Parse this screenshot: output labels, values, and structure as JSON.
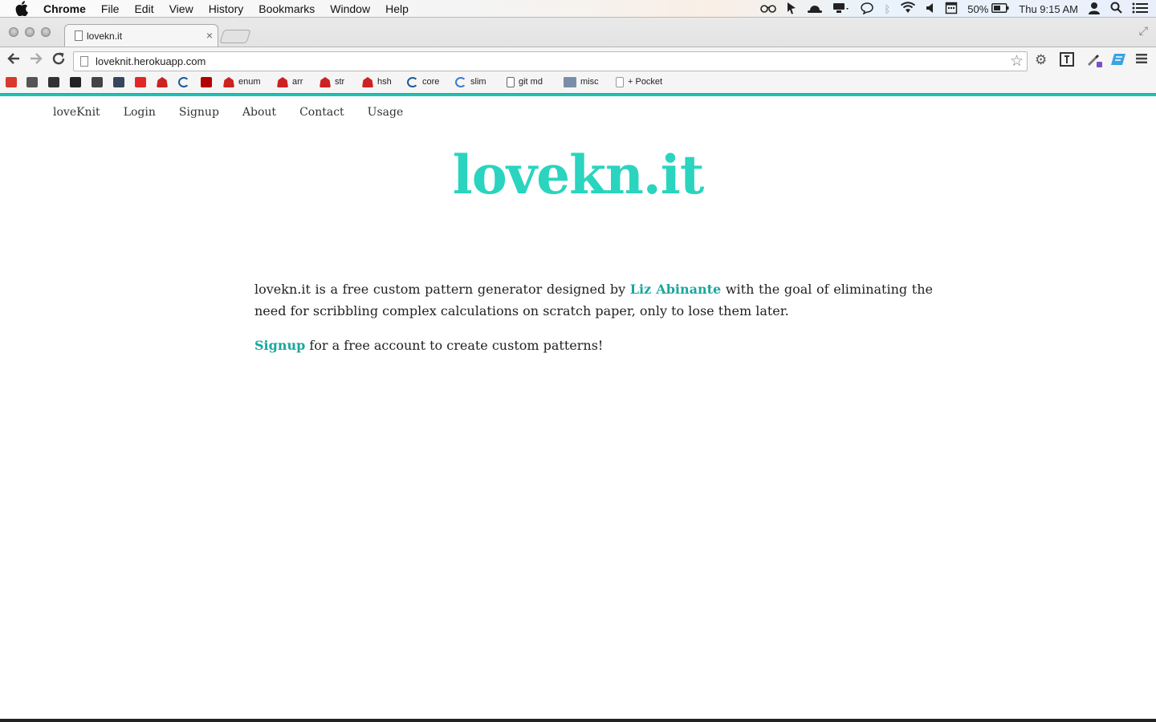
{
  "os_menubar": {
    "app_name": "Chrome",
    "menus": [
      "File",
      "Edit",
      "View",
      "History",
      "Bookmarks",
      "Window",
      "Help"
    ],
    "battery": "50%",
    "clock": "Thu 9:15 AM"
  },
  "browser": {
    "tab_title": "lovekn.it",
    "url": "loveknit.herokuapp.com",
    "bookmarks": [
      {
        "label": "",
        "icon": "gmail-icon",
        "color": "#d83a2e"
      },
      {
        "label": "",
        "icon": "puzzle-icon",
        "color": "#555555"
      },
      {
        "label": "",
        "icon": "circle-icon",
        "color": "#333333"
      },
      {
        "label": "",
        "icon": "github-icon",
        "color": "#222222"
      },
      {
        "label": "",
        "icon": "cloud-icon",
        "color": "#444444"
      },
      {
        "label": "",
        "icon": "tumblr-icon",
        "color": "#36465d"
      },
      {
        "label": "",
        "icon": "flipboard-icon",
        "color": "#e12828"
      },
      {
        "label": "",
        "icon": "ruby-icon",
        "color": "#cc2222"
      },
      {
        "label": "",
        "icon": "jquery-icon",
        "color": "#1b5b9a"
      },
      {
        "label": "",
        "icon": "rails-icon",
        "color": "#b30000"
      },
      {
        "label": "enum",
        "icon": "ruby-icon",
        "color": "#cc2222"
      },
      {
        "label": "arr",
        "icon": "ruby-icon",
        "color": "#cc2222"
      },
      {
        "label": "str",
        "icon": "ruby-icon",
        "color": "#cc2222"
      },
      {
        "label": "hsh",
        "icon": "ruby-icon",
        "color": "#cc2222"
      },
      {
        "label": "core",
        "icon": "jquery-icon",
        "color": "#1b5b9a"
      },
      {
        "label": "slim",
        "icon": "slim-icon",
        "color": "#3a7bd5"
      },
      {
        "label": "git md",
        "icon": "document-icon",
        "color": "#666666"
      },
      {
        "label": "misc",
        "icon": "folder-icon",
        "color": "#7a8ea8"
      },
      {
        "label": "+ Pocket",
        "icon": "page-icon",
        "color": "#999999"
      }
    ]
  },
  "site": {
    "nav": [
      "loveKnit",
      "Login",
      "Signup",
      "About",
      "Contact",
      "Usage"
    ],
    "logo": "lovekn.it",
    "intro_before": "lovekn.it is a free custom pattern generator designed by ",
    "author_link": "Liz Abinante",
    "intro_after": " with the goal of eliminating the need for scribbling complex calculations on scratch paper, only to lose them later.",
    "signup_link": "Signup",
    "signup_text": " for a free account to create custom patterns!",
    "accent_color": "#2ad4bf",
    "link_color": "#1aa79e"
  }
}
